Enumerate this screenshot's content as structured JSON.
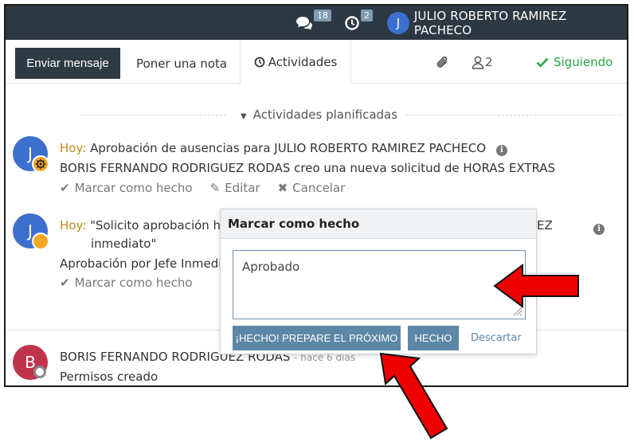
{
  "navbar": {
    "messages_count": "18",
    "activities_count": "2",
    "user_initial": "J",
    "user_name": "JULIO ROBERTO RAMIREZ PACHECO"
  },
  "toolbar": {
    "send_message": "Enviar mensaje",
    "log_note": "Poner una nota",
    "activities": "Actividades",
    "followers_count": "2",
    "following": "Siguiendo"
  },
  "separator": {
    "label": "Actividades planificadas"
  },
  "activity1": {
    "initial": "J",
    "when": "Hoy:",
    "summary": "Aprobación de ausencias",
    "for_text": "para JULIO ROBERTO RAMIREZ PACHECO",
    "note": "BORIS FERNANDO RODRIGUEZ RODAS creo una nueva solicitud de HORAS EXTRAS",
    "mark_done": "Marcar como hecho",
    "edit": "Editar",
    "cancel": "Cancelar"
  },
  "activity2": {
    "initial": "J",
    "when": "Hoy:",
    "summary_start": "\"Solicito aprobación h",
    "summary_end": "EZ",
    "summary_line2": "inmediato\"",
    "note": "Aprobación por Jefe Inmedi",
    "mark_done": "Marcar como hecho"
  },
  "message": {
    "initial": "B",
    "author": "BORIS FERNANDO RODRIGUEZ RODAS",
    "date": "- hace 6 días",
    "body": "Permisos creado"
  },
  "popover": {
    "title": "Marcar como hecho",
    "feedback": "Aprobado",
    "done_schedule_next": "¡HECHO! PREPARE EL PRÓXIMO",
    "done": "HECHO",
    "discard": "Descartar"
  },
  "colors": {
    "navbar": "#2c3843",
    "primary_button": "#2d3b45",
    "popover_button": "#5d87a6",
    "following": "#28a745",
    "today": "#c18a16",
    "avatar_blue": "#3d6fcf",
    "avatar_red": "#c0344a",
    "arrow_red": "#ee0000"
  }
}
